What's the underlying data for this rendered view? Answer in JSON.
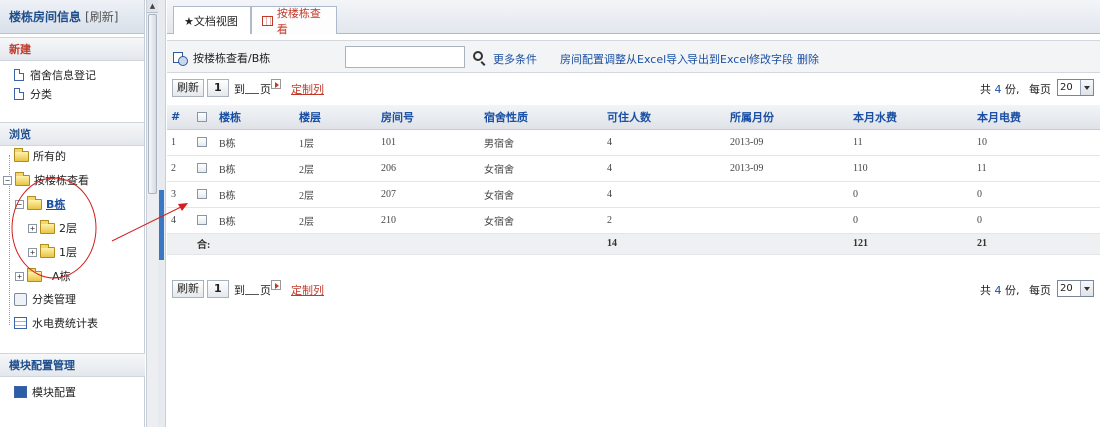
{
  "sidebar": {
    "title": "楼栋房间信息",
    "refresh": "[刷新]",
    "new_section": "新建",
    "new_items": [
      {
        "label": "宿舍信息登记"
      },
      {
        "label": "分类"
      }
    ],
    "browse_section": "浏览",
    "tree": {
      "all": "所有的",
      "by_building": "按楼栋查看",
      "building_b": "B栋",
      "floor2": "2层",
      "floor1": "1层",
      "building_a": "A栋",
      "category_mgmt": "分类管理",
      "stats": "水电费统计表"
    },
    "module_section": "模块配置管理",
    "module_item": "模块配置"
  },
  "tabs": [
    {
      "label": "★文档视图"
    },
    {
      "label": "按楼栋查看"
    }
  ],
  "toolbar": {
    "breadcrumb": "按楼栋查看/B栋",
    "search_value": "",
    "more_conditions": "更多条件",
    "actions": [
      "房间配置调整",
      "从Excel导入",
      "导出到Excel",
      "修改字段",
      "删除"
    ]
  },
  "pager": {
    "refresh": "刷新",
    "current_page": "1",
    "to_label": "到",
    "page_label": "页",
    "custom_columns": "定制列",
    "total_prefix": "共",
    "total": "4",
    "total_suffix": "份,",
    "per_page_label": "每页",
    "per_page": "20"
  },
  "table": {
    "headers": [
      "#",
      "",
      "楼栋",
      "楼层",
      "房间号",
      "宿舍性质",
      "可住人数",
      "所属月份",
      "本月水费",
      "本月电费"
    ],
    "rows": [
      [
        "1",
        "",
        "B栋",
        "1层",
        "101",
        "男宿舍",
        "4",
        "2013-09",
        "11",
        "10"
      ],
      [
        "2",
        "",
        "B栋",
        "2层",
        "206",
        "女宿舍",
        "4",
        "2013-09",
        "110",
        "11"
      ],
      [
        "3",
        "",
        "B栋",
        "2层",
        "207",
        "女宿舍",
        "4",
        "",
        "0",
        "0"
      ],
      [
        "4",
        "",
        "B栋",
        "2层",
        "210",
        "女宿舍",
        "2",
        "",
        "0",
        "0"
      ]
    ],
    "sum_label": "合:",
    "sum": {
      "capacity": "14",
      "water": "121",
      "electric": "21"
    }
  },
  "colors": {
    "link": "#1a4fa3",
    "accent_red": "#c0392b",
    "annotation": "#d21f1f",
    "splitter": "#3b78c3"
  }
}
